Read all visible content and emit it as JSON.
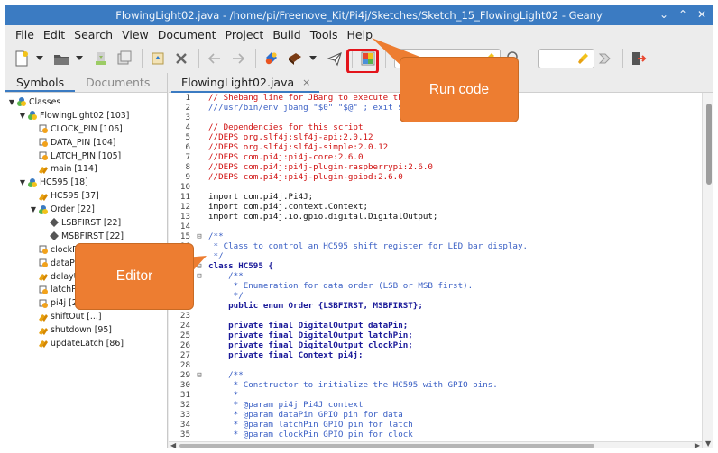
{
  "window": {
    "title": "FlowingLight02.java - /home/pi/Freenove_Kit/Pi4j/Sketches/Sketch_15_FlowingLight02 - Geany",
    "controls": [
      "⌄",
      "⌃",
      "✕"
    ]
  },
  "menu": [
    "File",
    "Edit",
    "Search",
    "View",
    "Document",
    "Project",
    "Build",
    "Tools",
    "Help"
  ],
  "colors": {
    "titlebar": "#3b7bc2",
    "callout": "#ed7d31",
    "highlight_box": "#e3141b",
    "comment": "#d01010",
    "doc_comment": "#3a5fc4",
    "keyword": "#1a1a99"
  },
  "toolbar": {
    "icons": [
      "new-file-icon",
      "open-file-icon",
      "save-icon",
      "save-all-icon",
      "revert-icon",
      "close-icon",
      "back-icon",
      "forward-icon",
      "compile-icon",
      "build-icon",
      "run-icon",
      "color-chooser-icon",
      "search-icon",
      "jump-to-line-icon",
      "quit-icon"
    ],
    "search_value": "",
    "goto_value": ""
  },
  "sidebar": {
    "tabs": [
      "Symbols",
      "Documents"
    ],
    "tree": [
      {
        "label": "Classes",
        "depth": 0,
        "expander": "▼",
        "icon": "class"
      },
      {
        "label": "FlowingLight02 [103]",
        "depth": 1,
        "expander": "▼",
        "icon": "class"
      },
      {
        "label": "CLOCK_PIN [106]",
        "depth": 2,
        "expander": "",
        "icon": "field"
      },
      {
        "label": "DATA_PIN [104]",
        "depth": 2,
        "expander": "",
        "icon": "field"
      },
      {
        "label": "LATCH_PIN [105]",
        "depth": 2,
        "expander": "",
        "icon": "field"
      },
      {
        "label": "main [114]",
        "depth": 2,
        "expander": "",
        "icon": "method"
      },
      {
        "label": "HC595 [18]",
        "depth": 1,
        "expander": "▼",
        "icon": "class"
      },
      {
        "label": "HC595 [37]",
        "depth": 2,
        "expander": "",
        "icon": "method"
      },
      {
        "label": "Order [22]",
        "depth": 2,
        "expander": "▼",
        "icon": "class"
      },
      {
        "label": "LSBFIRST [22]",
        "depth": 3,
        "expander": "",
        "icon": "enum"
      },
      {
        "label": "MSBFIRST [22]",
        "depth": 3,
        "expander": "",
        "icon": "enum"
      },
      {
        "label": "clockPin [26]",
        "depth": 2,
        "expander": "",
        "icon": "field"
      },
      {
        "label": "dataPin [24]",
        "depth": 2,
        "expander": "",
        "icon": "field"
      },
      {
        "label": "delayUs [...]",
        "depth": 2,
        "expander": "",
        "icon": "method"
      },
      {
        "label": "latchPin [25]",
        "depth": 2,
        "expander": "",
        "icon": "field"
      },
      {
        "label": "pi4j [27]",
        "depth": 2,
        "expander": "",
        "icon": "field"
      },
      {
        "label": "shiftOut [...]",
        "depth": 2,
        "expander": "",
        "icon": "method"
      },
      {
        "label": "shutdown [95]",
        "depth": 2,
        "expander": "",
        "icon": "method"
      },
      {
        "label": "updateLatch [86]",
        "depth": 2,
        "expander": "",
        "icon": "method"
      }
    ]
  },
  "editor": {
    "tab_label": "FlowingLight02.java",
    "tab_close": "×",
    "lines": [
      {
        "n": "1",
        "fold": "",
        "text": "// Shebang line for JBang to execute this s",
        "cls": "c-comment"
      },
      {
        "n": "2",
        "fold": "",
        "text": "///usr/bin/env jbang \"$0\" \"$@\" ; exit $?",
        "cls": "c-doc"
      },
      {
        "n": "3",
        "fold": "",
        "text": "",
        "cls": "c-plain"
      },
      {
        "n": "4",
        "fold": "",
        "text": "// Dependencies for this script",
        "cls": "c-comment"
      },
      {
        "n": "5",
        "fold": "",
        "text": "//DEPS org.slf4j:slf4j-api:2.0.12",
        "cls": "c-comment"
      },
      {
        "n": "6",
        "fold": "",
        "text": "//DEPS org.slf4j:slf4j-simple:2.0.12",
        "cls": "c-comment"
      },
      {
        "n": "7",
        "fold": "",
        "text": "//DEPS com.pi4j:pi4j-core:2.6.0",
        "cls": "c-comment"
      },
      {
        "n": "8",
        "fold": "",
        "text": "//DEPS com.pi4j:pi4j-plugin-raspberrypi:2.6.0",
        "cls": "c-comment"
      },
      {
        "n": "9",
        "fold": "",
        "text": "//DEPS com.pi4j:pi4j-plugin-gpiod:2.6.0",
        "cls": "c-comment"
      },
      {
        "n": "10",
        "fold": "",
        "text": "",
        "cls": "c-plain"
      },
      {
        "n": "11",
        "fold": "",
        "text": "import com.pi4j.Pi4J;",
        "cls": "c-plain"
      },
      {
        "n": "12",
        "fold": "",
        "text": "import com.pi4j.context.Context;",
        "cls": "c-plain"
      },
      {
        "n": "13",
        "fold": "",
        "text": "import com.pi4j.io.gpio.digital.DigitalOutput;",
        "cls": "c-plain"
      },
      {
        "n": "14",
        "fold": "",
        "text": "",
        "cls": "c-plain"
      },
      {
        "n": "15",
        "fold": "⊟",
        "text": "/**",
        "cls": "c-doc"
      },
      {
        "n": "16",
        "fold": "",
        "text": " * Class to control an HC595 shift register for LED bar display.",
        "cls": "c-doc"
      },
      {
        "n": "17",
        "fold": "",
        "text": " */",
        "cls": "c-doc"
      },
      {
        "n": "18",
        "fold": "⊟",
        "text": "class HC595 {",
        "cls": "c-kw"
      },
      {
        "n": "19",
        "fold": "⊟",
        "text": "    /**",
        "cls": "c-doc"
      },
      {
        "n": "20",
        "fold": "",
        "text": "     * Enumeration for data order (LSB or MSB first).",
        "cls": "c-doc"
      },
      {
        "n": "21",
        "fold": "",
        "text": "     */",
        "cls": "c-doc"
      },
      {
        "n": "22",
        "fold": "",
        "text": "    public enum Order {LSBFIRST, MSBFIRST};",
        "cls": "c-kw"
      },
      {
        "n": "23",
        "fold": "",
        "text": "",
        "cls": "c-plain"
      },
      {
        "n": "24",
        "fold": "",
        "text": "    private final DigitalOutput dataPin;",
        "cls": "c-kw"
      },
      {
        "n": "25",
        "fold": "",
        "text": "    private final DigitalOutput latchPin;",
        "cls": "c-kw"
      },
      {
        "n": "26",
        "fold": "",
        "text": "    private final DigitalOutput clockPin;",
        "cls": "c-kw"
      },
      {
        "n": "27",
        "fold": "",
        "text": "    private final Context pi4j;",
        "cls": "c-kw"
      },
      {
        "n": "28",
        "fold": "",
        "text": "",
        "cls": "c-plain"
      },
      {
        "n": "29",
        "fold": "⊟",
        "text": "    /**",
        "cls": "c-doc"
      },
      {
        "n": "30",
        "fold": "",
        "text": "     * Constructor to initialize the HC595 with GPIO pins.",
        "cls": "c-doc"
      },
      {
        "n": "31",
        "fold": "",
        "text": "     *",
        "cls": "c-doc"
      },
      {
        "n": "32",
        "fold": "",
        "text": "     * @param pi4j Pi4J context",
        "cls": "c-doc"
      },
      {
        "n": "33",
        "fold": "",
        "text": "     * @param dataPin GPIO pin for data",
        "cls": "c-doc"
      },
      {
        "n": "34",
        "fold": "",
        "text": "     * @param latchPin GPIO pin for latch",
        "cls": "c-doc"
      },
      {
        "n": "35",
        "fold": "",
        "text": "     * @param clockPin GPIO pin for clock",
        "cls": "c-doc"
      }
    ]
  },
  "callouts": {
    "run_code": "Run code",
    "editor": "Editor"
  }
}
